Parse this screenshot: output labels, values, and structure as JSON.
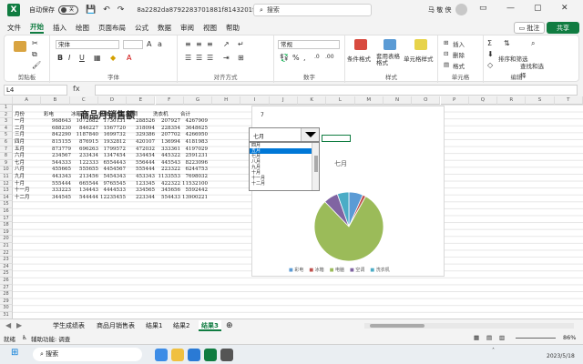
{
  "titlebar": {
    "autosave_label": "自动保存",
    "toggle_state": "关",
    "doc_title": "8a2282da8792283701881f814320​1f…",
    "search_placeholder": "搜索",
    "user_name": "马 敬 侠"
  },
  "menu": {
    "items": [
      "文件",
      "开始",
      "插入",
      "绘图",
      "页面布局",
      "公式",
      "数据",
      "审阅",
      "视图",
      "帮助"
    ],
    "active": "开始",
    "comment_label": "批注",
    "share_label": "共享"
  },
  "ribbon": {
    "clipboard_label": "剪贴板",
    "font_name": "宋体",
    "font_label": "字体",
    "align_label": "对齐方式",
    "number_format": "常规",
    "number_label": "数字",
    "styles": {
      "cond_format": "条件格式",
      "table_format": "套用表格格式",
      "cell_style": "单元格样式",
      "label": "样式"
    },
    "cells": {
      "insert": "插入",
      "delete": "删除",
      "format": "格式",
      "label": "单元格"
    },
    "editing": {
      "sort_filter": "排序和筛选",
      "find_select": "查找和选择",
      "label": "编辑"
    }
  },
  "formula_bar": {
    "name_box": "L4",
    "fx": "fx",
    "formula": ""
  },
  "sheet": {
    "title": "商品月销售额",
    "columns": [
      "A",
      "B",
      "C",
      "D",
      "E",
      "F",
      "G",
      "H",
      "I",
      "J",
      "K",
      "L",
      "M",
      "N",
      "O",
      "P",
      "Q",
      "R",
      "S",
      "T"
    ],
    "header_row": [
      "月份",
      "彩电",
      "冰箱",
      "电脑",
      "空调",
      "洗衣机",
      "合计"
    ],
    "rows": [
      [
        "一月",
        "968643",
        "1072682",
        "1730131",
        "288526",
        "207927",
        "4267909"
      ],
      [
        "二月",
        "688230",
        "846227",
        "1567720",
        "318094",
        "228354",
        "3648625"
      ],
      [
        "三月",
        "842290",
        "1187840",
        "1699732",
        "329386",
        "207702",
        "4266950"
      ],
      [
        "四月",
        "815155",
        "876915",
        "1932812",
        "420107",
        "136994",
        "4181983"
      ],
      [
        "五月",
        "873779",
        "696263",
        "1799572",
        "472032",
        "333361",
        "4197029"
      ],
      [
        "六月",
        "234567",
        "233434",
        "1347454",
        "334454",
        "445322",
        "2591231"
      ],
      [
        "七月",
        "544333",
        "122333",
        "6554443",
        "556444",
        "445543",
        "8223096"
      ],
      [
        "八月",
        "455665",
        "555655",
        "4454567",
        "555444",
        "223322",
        "6244753"
      ],
      [
        "九月",
        "443343",
        "213456",
        "5454343",
        "453343",
        "1133553",
        "7698032"
      ],
      [
        "十月",
        "555444",
        "665544",
        "9765545",
        "123345",
        "422322",
        "11532100"
      ],
      [
        "十一月",
        "333223",
        "134443",
        "4444533",
        "334565",
        "345656",
        "5592442"
      ],
      [
        "十二月",
        "344545",
        "544444",
        "12235455",
        "223344",
        "554433",
        "13900221"
      ]
    ],
    "helper_value": "7"
  },
  "combobox": {
    "value": "七月",
    "options": [
      "四月",
      "五月",
      "七月",
      "八月",
      "九月",
      "十月",
      "十一月",
      "十二月"
    ],
    "selected_index": 1
  },
  "chart_data": {
    "type": "pie",
    "title": "七月",
    "categories": [
      "彩电",
      "冰箱",
      "电脑",
      "空调",
      "洗衣机"
    ],
    "values": [
      544333,
      122333,
      6554443,
      556444,
      445543
    ],
    "colors": [
      "#5b9bd5",
      "#c0504d",
      "#9bbb59",
      "#8064a2",
      "#4bacc6"
    ]
  },
  "tabs": {
    "items": [
      "学生成绩表",
      "商品月销售表",
      "结果1",
      "结果2",
      "结果3"
    ],
    "active": "结果3"
  },
  "status": {
    "ready": "就绪",
    "accessibility": "辅助功能: 调查",
    "zoom": "86%"
  },
  "taskbar": {
    "search_label": "搜索",
    "date": "2023/5/18"
  }
}
